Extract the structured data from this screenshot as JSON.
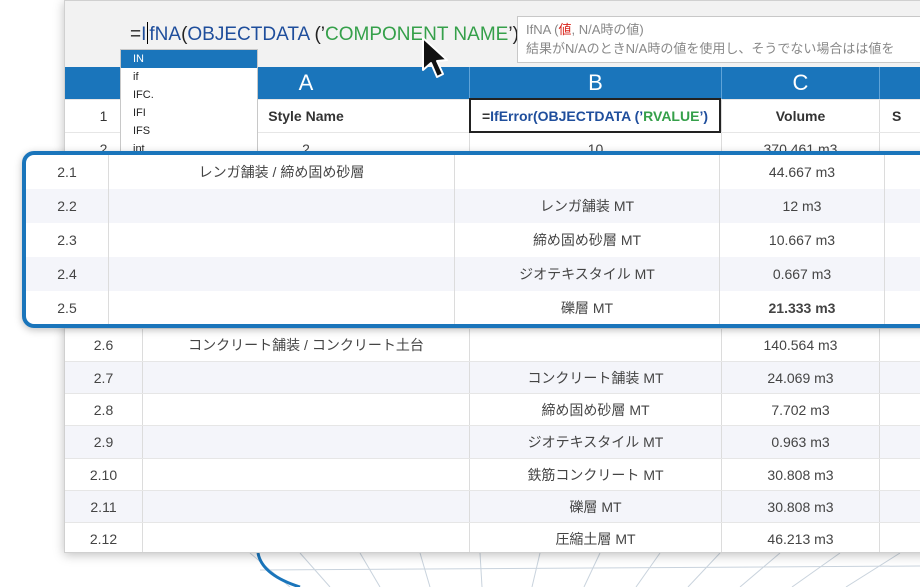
{
  "formula_bar": {
    "prefix": "=",
    "fn_typed": "I",
    "fn_rest": "fNA",
    "open": "(",
    "fn2": "OBJECTDATA",
    "arg_open": " (’",
    "arg": "COMPONENT NAME",
    "arg_close": "’)"
  },
  "tooltip": {
    "line1_pre": "IfNA (",
    "line1_hl": "値",
    "line1_post": ", N/A時の値)",
    "line2": "結果がN/AのときN/A時の値を使用し、そうでない場合はは値を"
  },
  "autocomplete": {
    "items": [
      "IN",
      "if",
      "IFC.",
      "IFI",
      "IFS",
      "int"
    ],
    "selected": "IN"
  },
  "columns": {
    "a": "A",
    "b": "B",
    "c": "C"
  },
  "header_row": {
    "num": "1",
    "a": "Style Name",
    "b_pre": "=",
    "b_fn": "IfError",
    "b_mid": "(OBJECTDATA (’",
    "b_str": "RVALUE",
    "b_post": "’)",
    "c": "Volume",
    "d": "S"
  },
  "row2": {
    "num": "2",
    "a": "2",
    "b": "10",
    "c": "370.461 m3"
  },
  "callout_rows": [
    {
      "num": "2.1",
      "a": "レンガ舗装 / 締め固め砂層",
      "b": "",
      "c": "44.667 m3"
    },
    {
      "num": "2.2",
      "a": "",
      "b": "レンガ舗装 MT",
      "c": "12 m3"
    },
    {
      "num": "2.3",
      "a": "",
      "b": "締め固め砂層 MT",
      "c": "10.667 m3"
    },
    {
      "num": "2.4",
      "a": "",
      "b": "ジオテキスタイル MT",
      "c": "0.667 m3"
    },
    {
      "num": "2.5",
      "a": "",
      "b": "礫層 MT",
      "c": "21.333 m3"
    }
  ],
  "rows": [
    {
      "num": "2.6",
      "a": "コンクリート舗装 / コンクリート土台",
      "b": "",
      "c": "140.564 m3"
    },
    {
      "num": "2.7",
      "a": "",
      "b": "コンクリート舗装 MT",
      "c": "24.069 m3"
    },
    {
      "num": "2.8",
      "a": "",
      "b": "締め固め砂層 MT",
      "c": "7.702 m3"
    },
    {
      "num": "2.9",
      "a": "",
      "b": "ジオテキスタイル MT",
      "c": "0.963 m3"
    },
    {
      "num": "2.10",
      "a": "",
      "b": "鉄筋コンクリート MT",
      "c": "30.808 m3"
    },
    {
      "num": "2.11",
      "a": "",
      "b": "礫層 MT",
      "c": "30.808 m3"
    },
    {
      "num": "2.12",
      "a": "",
      "b": "圧縮土層 MT",
      "c": "46.213 m3"
    }
  ],
  "colors": {
    "accent_blue": "#1a75bb",
    "function_blue": "#1f4e9c",
    "string_green": "#35a04a",
    "tooltip_highlight": "#d9241c"
  },
  "icons": {
    "cursor": "mouse-pointer-icon"
  }
}
